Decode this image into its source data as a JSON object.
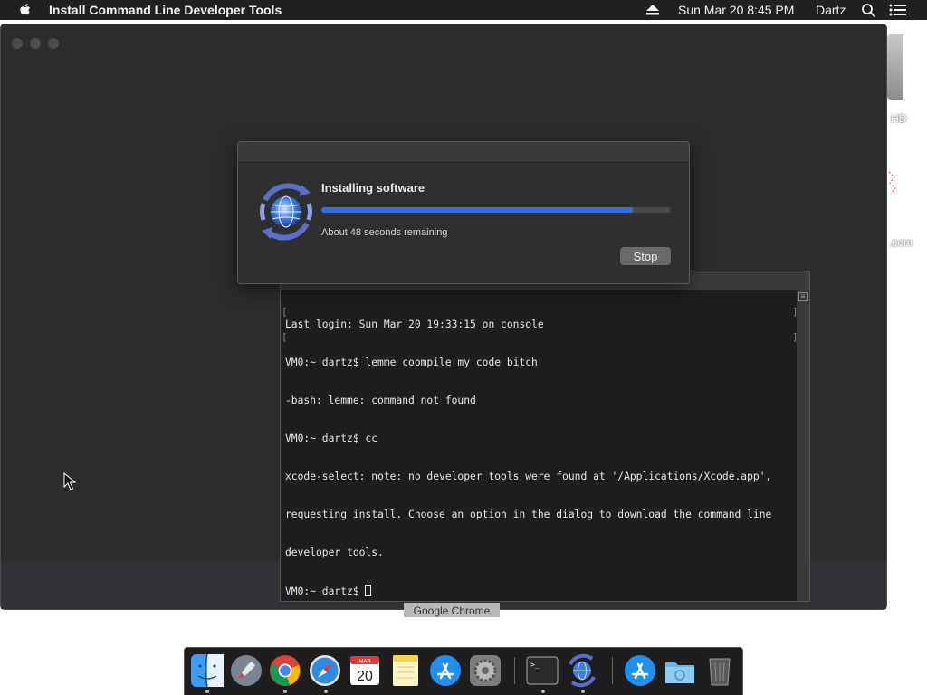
{
  "menubar": {
    "app_title": "Install Command Line Developer Tools",
    "clock": "Sun Mar 20  8:45 PM",
    "user": "Dartz",
    "icons": [
      "apple-icon",
      "eject-icon",
      "spotlight-icon",
      "notification-center-icon"
    ]
  },
  "desktop": {
    "hd_label": "HD",
    "com_label": ".com"
  },
  "installer": {
    "heading": "Installing software",
    "progress_fraction": 0.89,
    "remaining": "About 48 seconds remaining",
    "stop_label": "Stop"
  },
  "terminal": {
    "lines": [
      "Last login: Sun Mar 20 19:33:15 on console",
      "VM0:~ dartz$ lemme coompile my code bitch",
      "-bash: lemme: command not found",
      "VM0:~ dartz$ cc",
      "xcode-select: note: no developer tools were found at '/Applications/Xcode.app',",
      "requesting install. Choose an option in the dialog to download the command line",
      "developer tools."
    ],
    "prompt": "VM0:~ dartz$ "
  },
  "tooltip": "Google Chrome",
  "dock": {
    "items": [
      {
        "name": "finder",
        "icon": "finder-icon",
        "running": true
      },
      {
        "name": "launchpad",
        "icon": "launchpad-icon",
        "running": false
      },
      {
        "name": "google-chrome",
        "icon": "chrome-icon",
        "running": true
      },
      {
        "name": "safari",
        "icon": "safari-icon",
        "running": true
      },
      {
        "name": "calendar",
        "icon": "calendar-icon",
        "running": false,
        "month": "MAR",
        "day": "20"
      },
      {
        "name": "notes",
        "icon": "notes-icon",
        "running": false
      },
      {
        "name": "app-store",
        "icon": "app-store-icon",
        "running": false
      },
      {
        "name": "system-preferences",
        "icon": "system-preferences-icon",
        "running": false
      },
      {
        "name": "terminal",
        "icon": "terminal-icon",
        "running": true
      },
      {
        "name": "installer",
        "icon": "install-command-line-tools-icon",
        "running": true
      },
      {
        "name": "downloads-app-store",
        "icon": "app-store-icon",
        "running": false
      },
      {
        "name": "downloads-folder",
        "icon": "folder-icon",
        "running": false
      },
      {
        "name": "trash",
        "icon": "trash-icon",
        "running": false
      }
    ]
  }
}
